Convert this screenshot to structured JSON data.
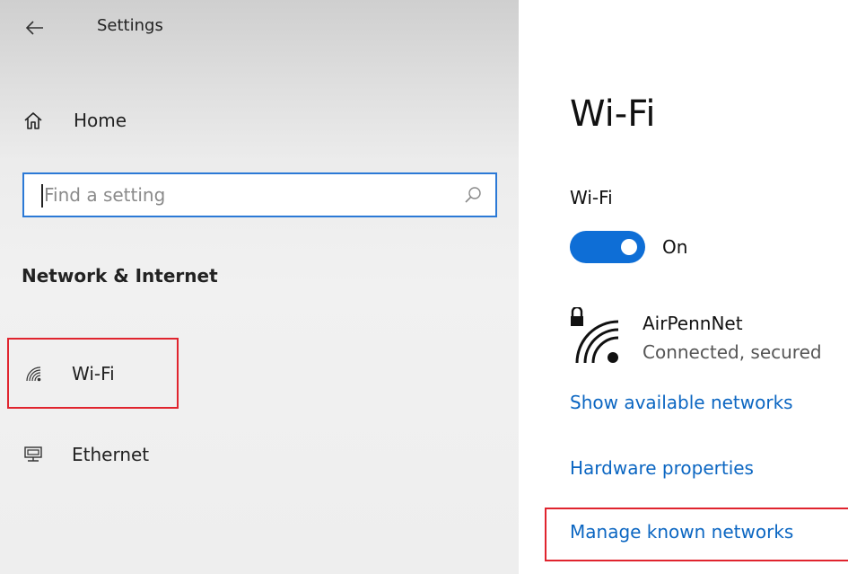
{
  "sidebar": {
    "app_title": "Settings",
    "home_label": "Home",
    "search": {
      "placeholder": "Find a setting",
      "value": ""
    },
    "section_title": "Network & Internet",
    "items": [
      {
        "label": "Wi-Fi",
        "icon": "wifi-icon"
      },
      {
        "label": "Ethernet",
        "icon": "ethernet-icon"
      }
    ]
  },
  "main": {
    "title": "Wi-Fi",
    "wifi_toggle": {
      "label": "Wi-Fi",
      "state": "On",
      "on": true
    },
    "network": {
      "name": "AirPennNet",
      "status": "Connected, secured",
      "icon": "secured-wifi-icon"
    },
    "links": {
      "show_available": "Show available networks",
      "hardware": "Hardware properties",
      "manage_known": "Manage known networks"
    }
  },
  "colors": {
    "accent": "#0e6ed6",
    "link": "#0b66c2",
    "highlight": "#e0242e",
    "search_border": "#2b79d6"
  }
}
